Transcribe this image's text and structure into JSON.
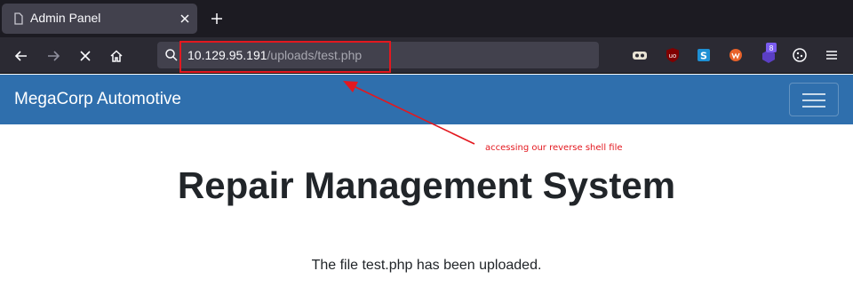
{
  "browser": {
    "tab": {
      "title": "Admin Panel",
      "favicon": "page-icon"
    },
    "new_tab": "plus-icon",
    "toolbar": {
      "back": "back-arrow-icon",
      "forward": "forward-arrow-icon",
      "stop": "stop-loading-icon",
      "home": "home-icon"
    },
    "url": {
      "host": "10.129.95.191",
      "path": "/uploads/test.php",
      "search_icon": "search-icon"
    },
    "extensions": [
      {
        "name": "tampermonkey-icon"
      },
      {
        "name": "ublock-origin-icon",
        "label": "uo"
      },
      {
        "name": "s-extension-icon",
        "label": "S"
      },
      {
        "name": "wappalyzer-icon"
      },
      {
        "name": "hacktools-icon",
        "badge": "8"
      },
      {
        "name": "cookie-editor-icon"
      },
      {
        "name": "menu-icon"
      }
    ]
  },
  "site": {
    "brand": "MegaCorp Automotive",
    "menu_toggle": "hamburger-icon"
  },
  "main": {
    "title": "Repair Management System",
    "message": "The file test.php has been uploaded."
  },
  "annotation": {
    "text": "accessing our reverse shell file",
    "color": "#e3181f"
  },
  "colors": {
    "tabstrip": "#1c1b22",
    "toolbar": "#2b2a33",
    "urlbar": "#42414d",
    "navbar": "#2f6fad",
    "annotation": "#e3181f"
  }
}
